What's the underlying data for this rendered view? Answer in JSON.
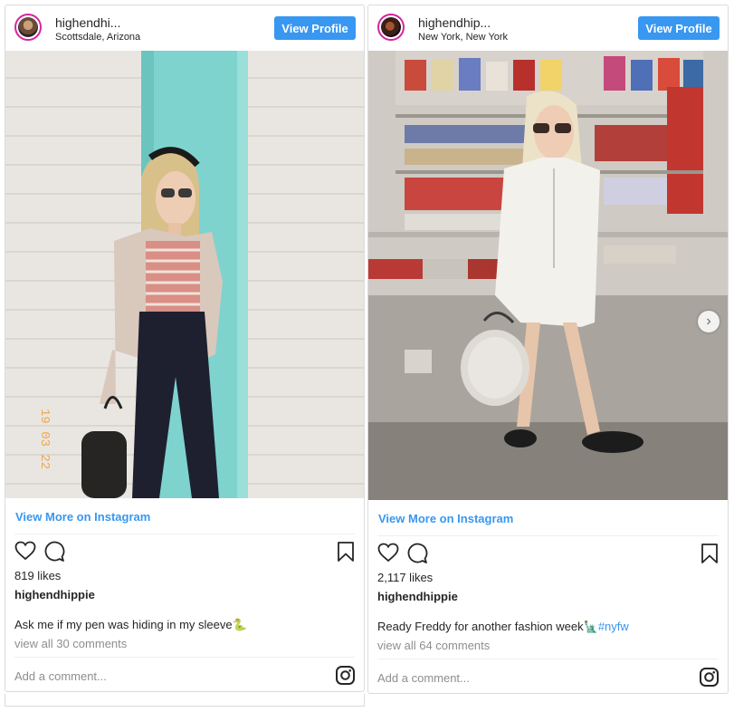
{
  "posts": [
    {
      "username": "highendhi...",
      "location": "Scottsdale, Arizona",
      "view_profile": "View Profile",
      "view_more": "View More on Instagram",
      "likes": "819 likes",
      "owner": "highendhippie",
      "caption": "Ask me if my pen was hiding in my sleeve",
      "caption_emoji": "🐍",
      "caption_tag": "",
      "comments": "view all 30 comments",
      "add_comment": "Add a comment...",
      "photo_stamp": "19 03 22"
    },
    {
      "username": "highendhip...",
      "location": "New York, New York",
      "view_profile": "View Profile",
      "view_more": "View More on Instagram",
      "likes": "2,117 likes",
      "owner": "highendhippie",
      "caption": "Ready Freddy for another fashion week",
      "caption_emoji": "🗽",
      "caption_tag": "#nyfw",
      "comments": "view all 64 comments",
      "add_comment": "Add a comment..."
    }
  ],
  "icons": [
    "heart-icon",
    "comment-icon",
    "bookmark-icon",
    "instagram-icon",
    "chevron-right-icon"
  ],
  "colors": {
    "accent": "#3897f0",
    "border": "#dbdbdb",
    "muted": "#8e8e8e",
    "ring": "#d6249f"
  }
}
